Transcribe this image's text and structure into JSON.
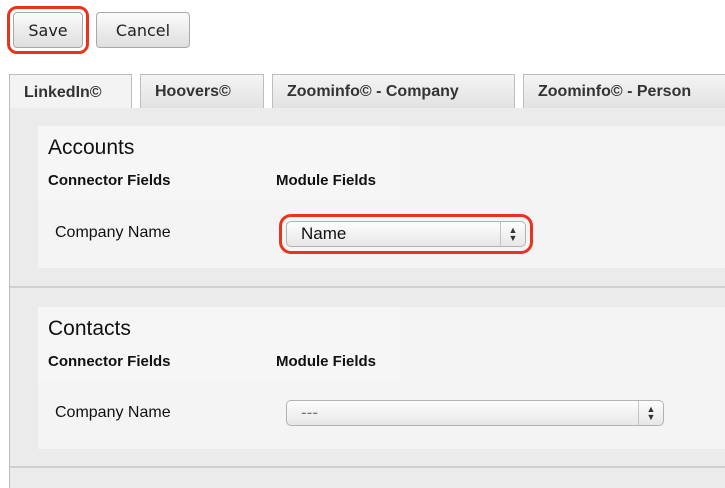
{
  "toolbar": {
    "save_label": "Save",
    "cancel_label": "Cancel"
  },
  "tabs": [
    {
      "label": "LinkedIn©",
      "active": true
    },
    {
      "label": "Hoovers©",
      "active": false
    },
    {
      "label": "Zoominfo© - Company",
      "active": false
    },
    {
      "label": "Zoominfo© - Person",
      "active": false
    }
  ],
  "sections": [
    {
      "title": "Accounts",
      "connector_fields_header": "Connector Fields",
      "module_fields_header": "Module Fields",
      "row_label": "Company Name",
      "select_value": "Name"
    },
    {
      "title": "Contacts",
      "connector_fields_header": "Connector Fields",
      "module_fields_header": "Module Fields",
      "row_label": "Company Name",
      "select_value": "---"
    }
  ],
  "colors": {
    "highlight": "#e8341c",
    "panel_background": "#ebebeb"
  }
}
